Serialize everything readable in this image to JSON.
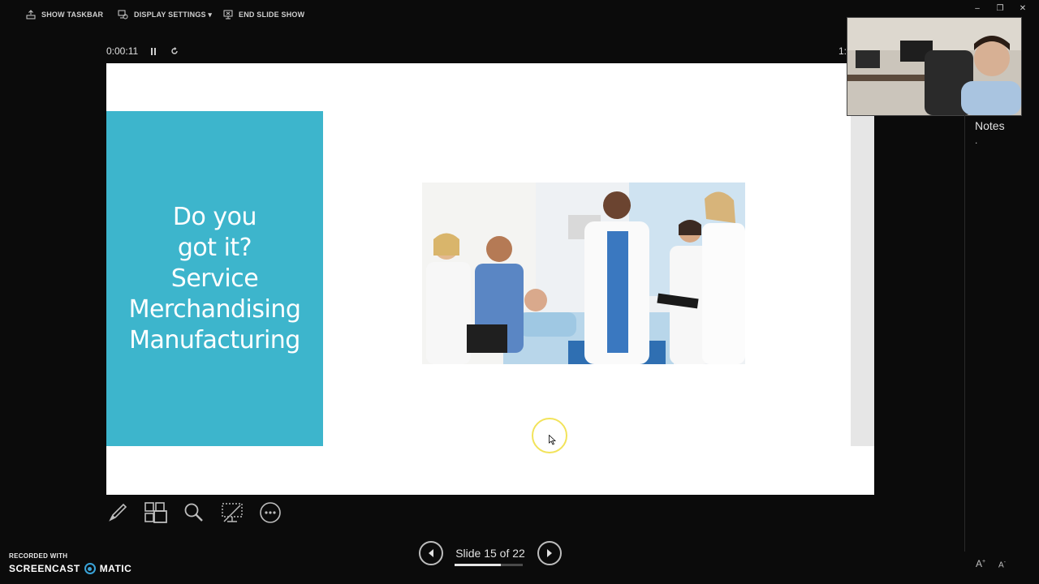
{
  "toolbar": {
    "show_taskbar": "SHOW TASKBAR",
    "display_settings": "DISPLAY SETTINGS ▾",
    "end_slide_show": "END SLIDE SHOW"
  },
  "window_controls": {
    "minimize": "–",
    "restore": "❐",
    "close": "✕"
  },
  "timer": {
    "elapsed": "0:00:11",
    "clock_fragment": "1:"
  },
  "slide": {
    "title_lines": [
      "Do you",
      "got it?",
      "Service",
      "Merchandising",
      "Manufacturing"
    ],
    "panel_color": "#3db5cc"
  },
  "notes": {
    "label": "Notes",
    "placeholder_mark": "."
  },
  "text_size": {
    "increase": "A",
    "decrease": "A"
  },
  "navigation": {
    "counter": "Slide 15 of 22",
    "current": 15,
    "total": 22,
    "progress_fraction": 0.68
  },
  "watermark": {
    "line1": "RECORDED WITH",
    "brand_left": "SCREENCAST",
    "brand_right": "MATIC"
  }
}
